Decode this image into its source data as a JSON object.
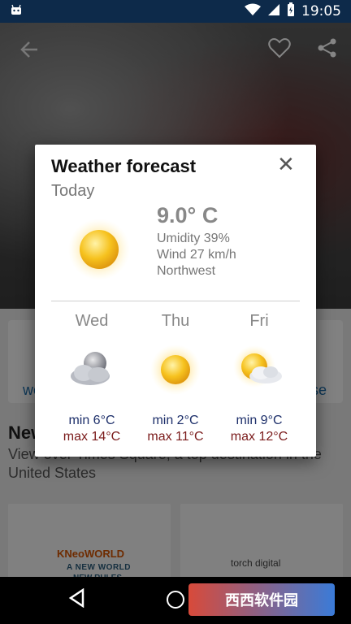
{
  "status_bar": {
    "time": "19:05",
    "icons": [
      "android-icon",
      "wifi-icon",
      "signal-icon",
      "battery-icon"
    ]
  },
  "top_bar": {
    "icons": [
      "back-arrow-icon",
      "heart-icon",
      "share-icon"
    ]
  },
  "background": {
    "action_left": "we",
    "action_right": "ose",
    "news_title": "New",
    "news_desc": "View over Times Square, a top destination in the United States",
    "tile1_brand": "KNeoWORLD",
    "tile1_line1": "A NEW WORLD",
    "tile1_line2": "NEW RULES",
    "tile2_brand": "torch digital"
  },
  "dialog": {
    "title": "Weather forecast",
    "today_label": "Today",
    "temperature": "9.0° C",
    "humidity": "Umidity 39%",
    "wind": "Wind 27 km/h",
    "direction": "Northwest",
    "today_icon": "sun-icon",
    "forecast": [
      {
        "day": "Wed",
        "icon": "cloud-moon-icon",
        "min": "min 6°C",
        "max": "max 14°C"
      },
      {
        "day": "Thu",
        "icon": "sun-icon",
        "min": "min 2°C",
        "max": "max 11°C"
      },
      {
        "day": "Fri",
        "icon": "sun-cloud-icon",
        "min": "min 9°C",
        "max": "max 12°C"
      }
    ]
  },
  "nav_bar": {
    "icons": [
      "back-triangle-icon",
      "home-circle-icon"
    ],
    "watermark": "西西软件园"
  },
  "colors": {
    "status_bar": "#0d2a4a",
    "min_temp": "#1d2f6a",
    "max_temp": "#7a1a1a",
    "muted_text": "#777777"
  }
}
